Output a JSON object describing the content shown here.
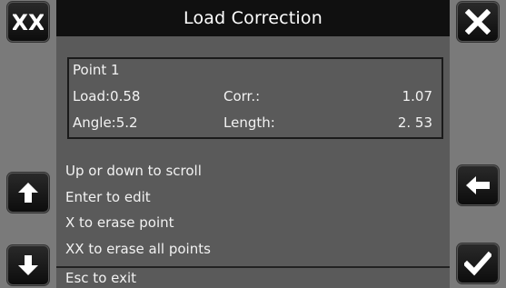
{
  "title": "Load Correction",
  "buttons": {
    "left": [
      "clear-all",
      "scroll-up",
      "scroll-down"
    ],
    "right": [
      "close",
      "back",
      "confirm"
    ],
    "clear_all_label": "XX"
  },
  "point": {
    "header": "Point 1",
    "load_label": "Load:0.58",
    "corr_label": "Corr.:",
    "corr_value": "1.07",
    "angle_label": "Angle:5.2",
    "length_label": "Length:",
    "length_value": "2. 53"
  },
  "help": [
    "Up or down to scroll",
    "Enter to edit",
    "X to erase point",
    "XX to erase all points"
  ],
  "footer": "Esc to exit",
  "colors": {
    "background": "#5a5a5a",
    "title_bar": "#101010",
    "side_panel": "#7a7a7a",
    "button": "#151515",
    "text": "#f2f2f2"
  }
}
